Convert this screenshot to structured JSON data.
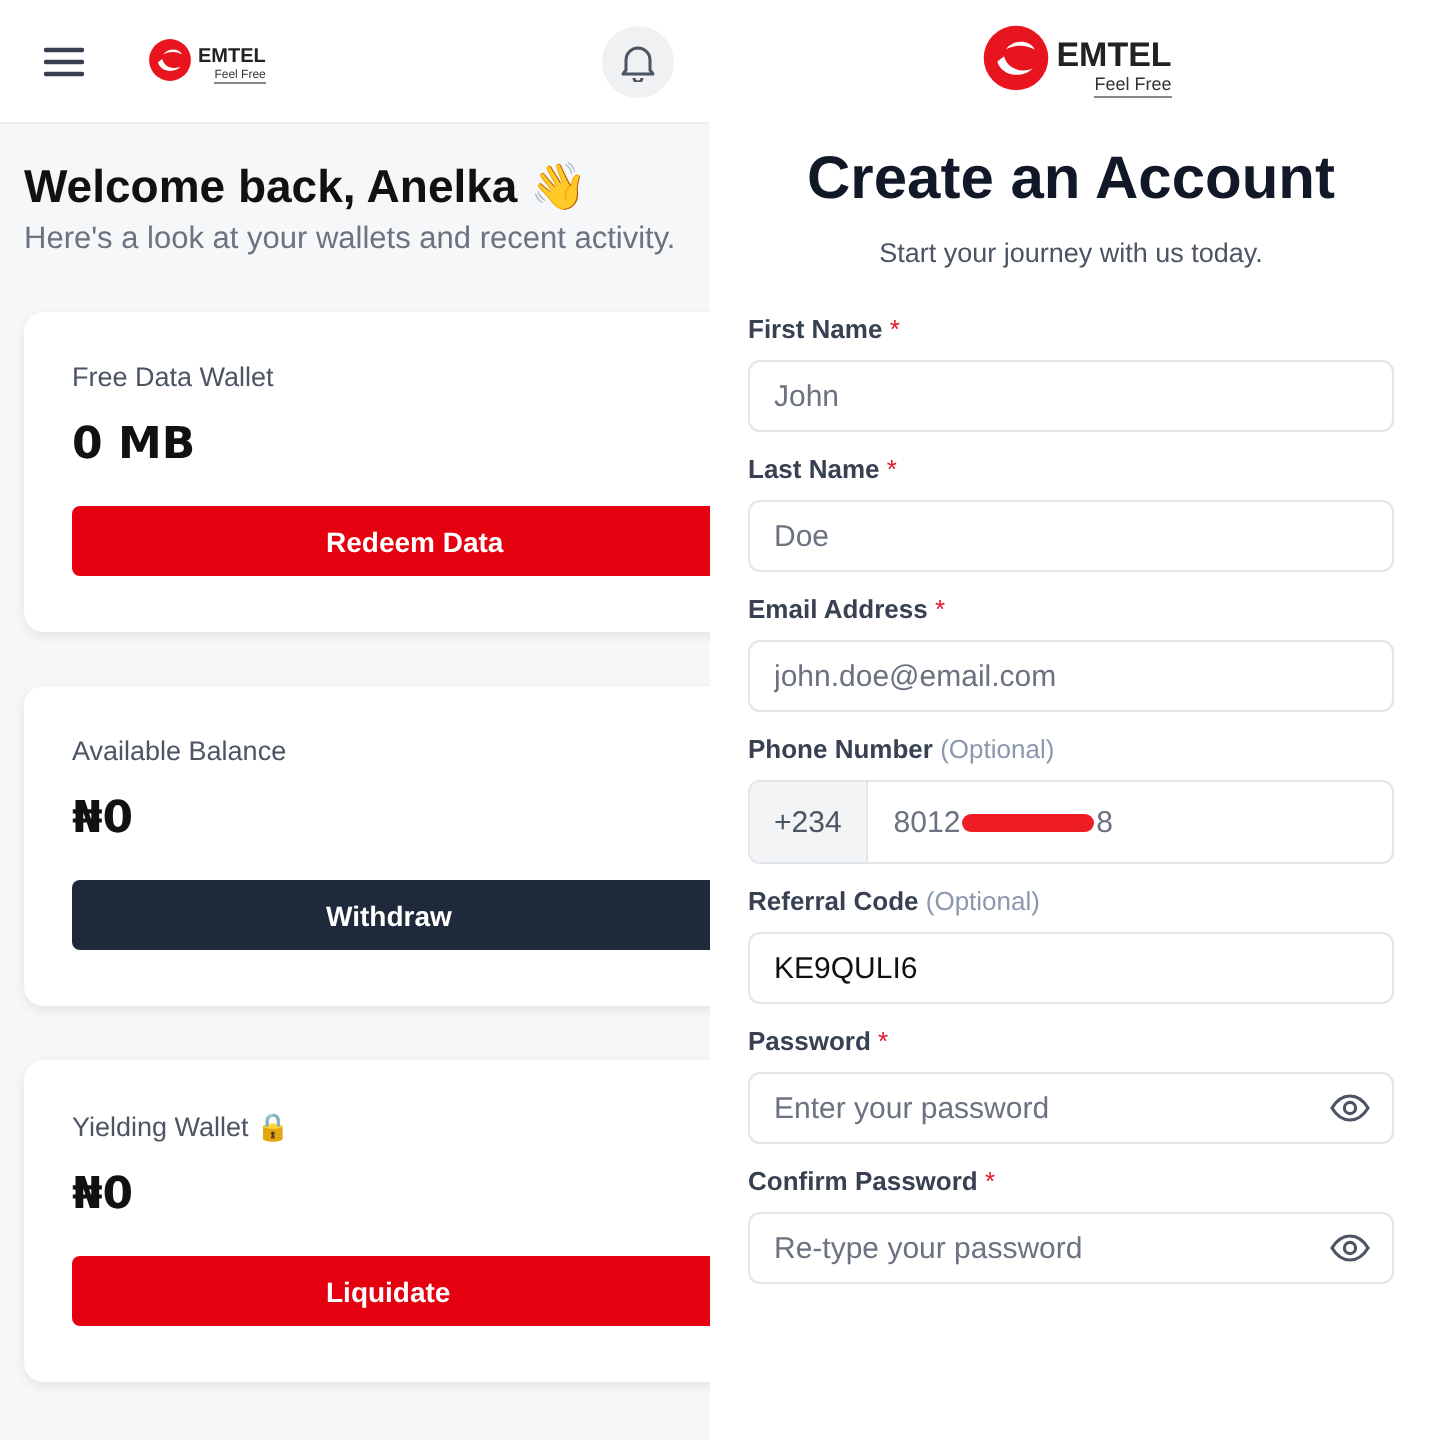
{
  "dashboard": {
    "logo": {
      "name": "EMTEL",
      "tagline": "Feel Free"
    },
    "title": "Welcome back, Anelka 👋",
    "subtitle": "Here's a look at your wallets and recent activity.",
    "wallets": [
      {
        "label": "Free Data Wallet",
        "amount": "0 MB",
        "button": "Redeem Data",
        "kind": "primary"
      },
      {
        "label": "Available Balance",
        "amount": "₦0",
        "button": "Withdraw",
        "kind": "dark"
      },
      {
        "label": "Yielding Wallet 🔒",
        "amount": "₦0",
        "button": "Liquidate",
        "kind": "primary"
      }
    ]
  },
  "signup": {
    "logo": {
      "name": "EMTEL",
      "tagline": "Feel Free"
    },
    "title": "Create an Account",
    "subtitle": "Start your journey with us today.",
    "fields": [
      {
        "label": "First Name",
        "marker": "*",
        "placeholder": "John",
        "kind": "text"
      },
      {
        "label": "Last Name",
        "marker": "*",
        "placeholder": "Doe",
        "kind": "text"
      },
      {
        "label": "Email Address",
        "marker": "*",
        "placeholder": "john.doe@email.com",
        "kind": "text"
      },
      {
        "label": "Phone Number",
        "marker": "(Optional)",
        "prefix": "+234",
        "value_start": "8012",
        "value_end": "8",
        "redacted": true,
        "kind": "phone"
      },
      {
        "label": "Referral Code",
        "marker": "(Optional)",
        "value": "KE9QULI6",
        "kind": "text"
      },
      {
        "label": "Password",
        "marker": "*",
        "placeholder": "Enter your password",
        "kind": "password"
      },
      {
        "label": "Confirm Password",
        "marker": "*",
        "placeholder": "Re-type your password",
        "kind": "password"
      }
    ]
  }
}
